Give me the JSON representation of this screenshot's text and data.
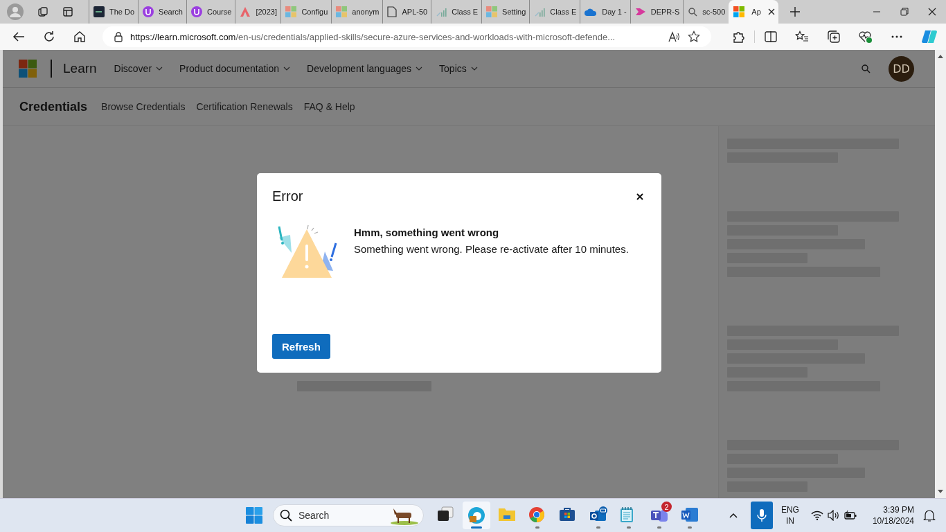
{
  "browser": {
    "tabs": [
      {
        "title": "The Do",
        "selected": false
      },
      {
        "title": "Search",
        "selected": false
      },
      {
        "title": "Course",
        "selected": false
      },
      {
        "title": "[2023]",
        "selected": false
      },
      {
        "title": "Configu",
        "selected": false
      },
      {
        "title": "anonym",
        "selected": false
      },
      {
        "title": "APL-50",
        "selected": false
      },
      {
        "title": "Class E",
        "selected": false
      },
      {
        "title": "Setting",
        "selected": false
      },
      {
        "title": "Class E",
        "selected": false
      },
      {
        "title": "Day 1 -",
        "selected": false
      },
      {
        "title": "DEPR-S",
        "selected": false
      },
      {
        "title": "sc-500",
        "selected": false
      },
      {
        "title": "Ap",
        "selected": true
      }
    ],
    "url": {
      "host": "https://learn.microsoft.com",
      "path": "/en-us/credentials/applied-skills/secure-azure-services-and-workloads-with-microsoft-defende..."
    }
  },
  "site": {
    "brand": "Learn",
    "nav": [
      "Discover",
      "Product documentation",
      "Development languages",
      "Topics"
    ],
    "avatar": "DD",
    "subnav": {
      "title": "Credentials",
      "links": [
        "Browse Credentials",
        "Certification Renewals",
        "FAQ & Help"
      ]
    }
  },
  "dialog": {
    "title": "Error",
    "heading": "Hmm, something went wrong",
    "message": "Something went wrong. Please re-activate after 10 minutes.",
    "button": "Refresh"
  },
  "taskbar": {
    "search_placeholder": "Search",
    "apps": [
      {
        "kind": "taskview",
        "running": false,
        "active": false
      },
      {
        "kind": "edge",
        "running": true,
        "active": true
      },
      {
        "kind": "folder",
        "running": false,
        "active": false
      },
      {
        "kind": "chrome",
        "running": true,
        "active": false
      },
      {
        "kind": "store",
        "running": false,
        "active": false
      },
      {
        "kind": "outlook",
        "running": true,
        "active": false
      },
      {
        "kind": "notepad",
        "running": true,
        "active": false
      },
      {
        "kind": "teams",
        "running": true,
        "active": false,
        "badge": "2"
      },
      {
        "kind": "word",
        "running": true,
        "active": false
      }
    ],
    "language": [
      "ENG",
      "IN"
    ],
    "time": "3:39 PM",
    "date": "10/18/2024"
  }
}
